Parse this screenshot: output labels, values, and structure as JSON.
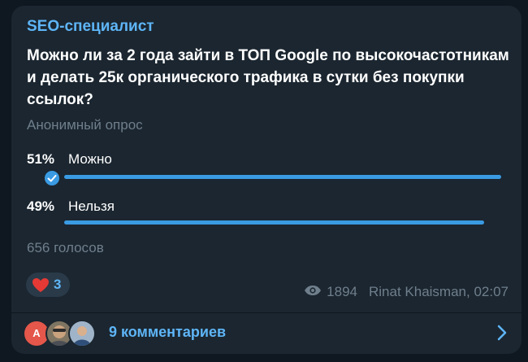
{
  "channel": {
    "name": "SEO-специалист"
  },
  "poll": {
    "question": "Можно ли за 2 года зайти в ТОП Google по высокочастотникам и делать 25к органического трафика в сутки без покупки ссылок?",
    "type_label": "Анонимный опрос",
    "options": [
      {
        "percent": "51%",
        "label": "Можно",
        "fraction": 0.51,
        "selected": true
      },
      {
        "percent": "49%",
        "label": "Нельзя",
        "fraction": 0.49,
        "selected": false
      }
    ],
    "votes_label": "656 голосов"
  },
  "reaction": {
    "icon": "heart-icon",
    "count": "3",
    "color": "#e53935"
  },
  "meta": {
    "views": "1894",
    "author_time": "Rinat Khaisman, 02:07"
  },
  "comments": {
    "label": "9 комментариев",
    "first_avatar_letter": "А"
  },
  "colors": {
    "accent": "#5eb5f7",
    "bar": "#3a9be3",
    "card": "#1b2630",
    "muted": "#6f7f8c"
  }
}
